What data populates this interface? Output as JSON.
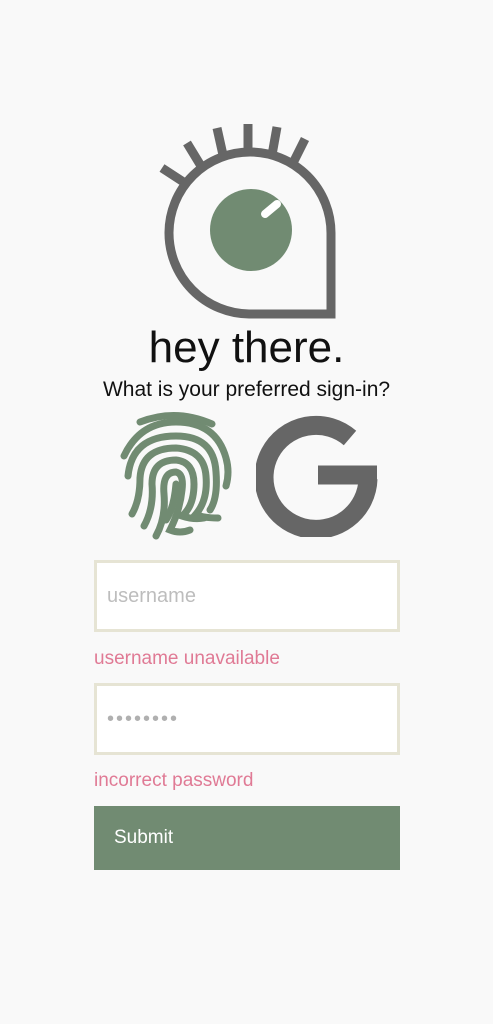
{
  "header": {
    "title": "hey there.",
    "subtitle": "What is your preferred sign-in?"
  },
  "signin_options": {
    "fingerprint_icon": "fingerprint-icon",
    "google_icon": "google-g-icon"
  },
  "form": {
    "username_placeholder": "username",
    "username_error": "username unavailable",
    "password_value": "••••••••",
    "password_error": "incorrect password",
    "submit_label": "Submit"
  },
  "colors": {
    "brand_green": "#718b72",
    "icon_gray": "#666666",
    "error_pink": "#e07a95",
    "field_border": "#e6e4d4",
    "background": "#f9f9f9"
  }
}
